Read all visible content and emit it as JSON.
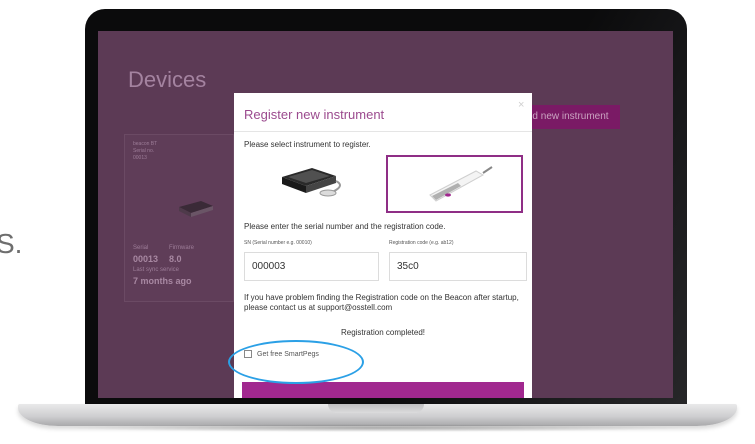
{
  "side_text": "S.",
  "page": {
    "title": "Devices",
    "add_button": "d new instrument"
  },
  "card": {
    "header_line1": "beacon BT",
    "header_line2": "Serial no.",
    "header_line3": "00013",
    "serial_label": "Serial",
    "serial_value": "00013",
    "firmware_label": "Firmware",
    "firmware_value": "8.0",
    "last_sync_label": "Last sync service",
    "last_sync_value": "7 months ago"
  },
  "modal": {
    "title": "Register new instrument",
    "close_label": "×",
    "select_prompt": "Please select instrument to register.",
    "serial_prompt": "Please enter the serial number and the registration code.",
    "sn_label": "SN (Serial number e.g. 00010)",
    "sn_value": "000003",
    "code_label": "Registration code (e.g. ab12)",
    "code_value": "35c0",
    "help_text": "If you have problem finding the Registration code on the Beacon after startup, please contact us at support@osstell.com",
    "status": "Registration completed!",
    "checkbox_label": "Get free SmartPegs"
  },
  "colors": {
    "accent": "#a1288f",
    "overlay_bg": "#5c3a55",
    "highlight": "#2ba0e6"
  }
}
